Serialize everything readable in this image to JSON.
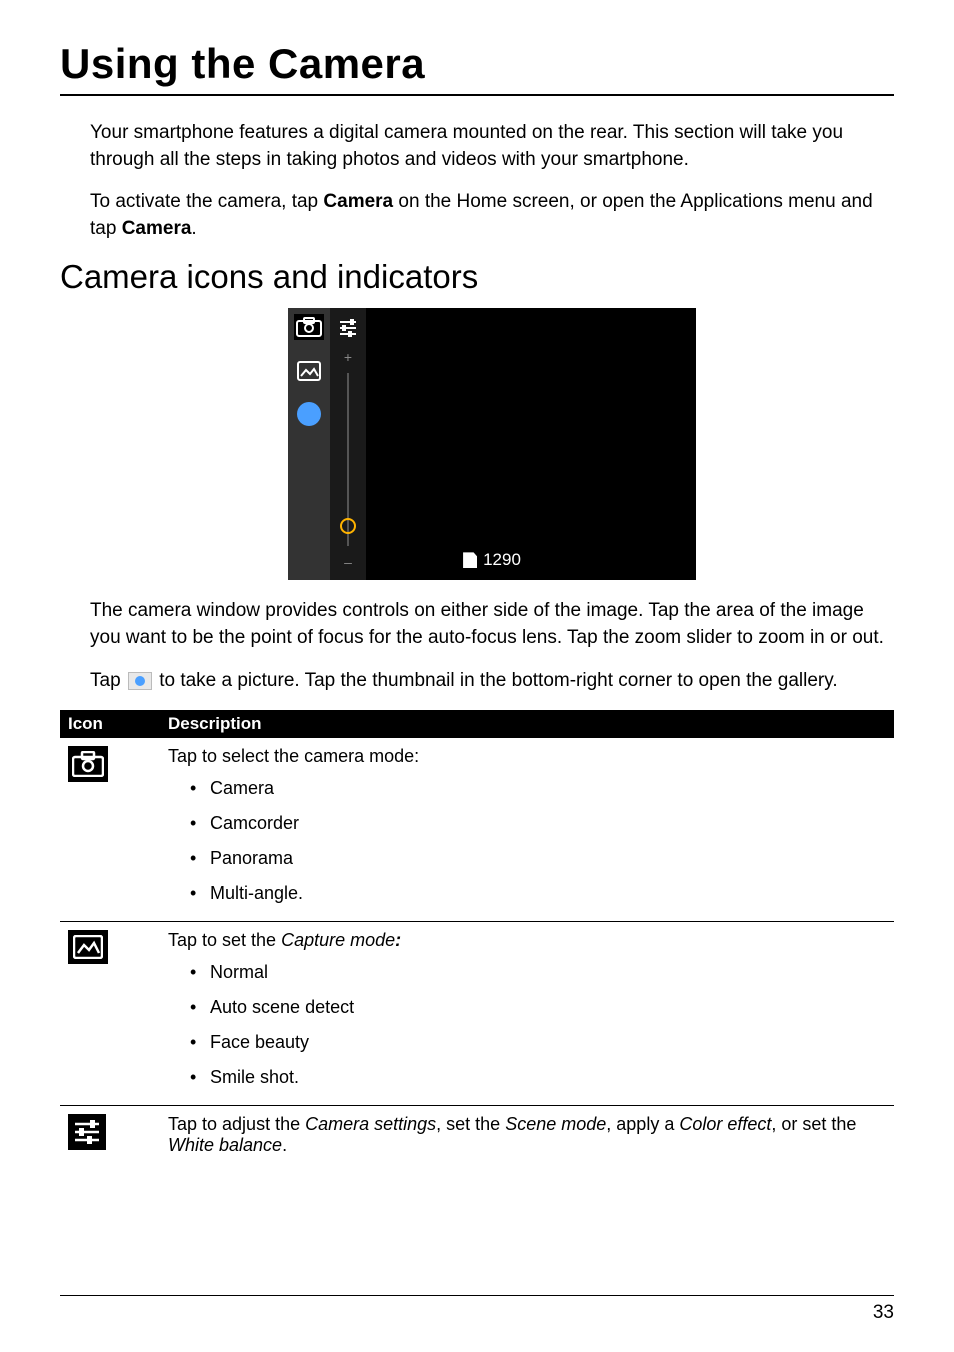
{
  "title": "Using the Camera",
  "intro1_a": "Your smartphone features a digital camera mounted on the rear. This section will take you through all the steps in taking photos and videos with your smartphone.",
  "intro2_a": "To activate the camera, tap ",
  "intro2_b": "Camera",
  "intro2_c": " on the Home screen, or open the Applications menu and tap ",
  "intro2_d": "Camera",
  "intro2_e": ".",
  "section_heading": "Camera icons and indicators",
  "screenshot": {
    "counter": "1290",
    "zoom_plus": "+",
    "zoom_minus": "–"
  },
  "after_shot_p1": "The camera window provides controls on either side of the image. Tap the area of the image you want to be the point of focus for the auto-focus lens. Tap the zoom slider to zoom in or out.",
  "after_shot_p2_a": "Tap ",
  "after_shot_p2_b": " to take a picture. Tap the thumbnail in the bottom-right corner to open the gallery.",
  "table": {
    "col_icon": "Icon",
    "col_desc": "Description",
    "rows": [
      {
        "lead": "Tap to select the camera mode:",
        "items": [
          "Camera",
          "Camcorder",
          "Panorama",
          "Multi-angle."
        ]
      },
      {
        "lead_a": "Tap to set the ",
        "lead_em": "Capture mode",
        "lead_colon": ":",
        "items": [
          "Normal",
          "Auto scene detect",
          "Face beauty",
          "Smile shot."
        ]
      },
      {
        "lead_a": "Tap to adjust the ",
        "em1": "Camera settings",
        "mid1": ", set the ",
        "em2": "Scene mode",
        "mid2": ", apply a ",
        "em3": "Color effect",
        "mid3": ", or set the ",
        "em4": "White balance",
        "end": "."
      }
    ]
  },
  "page_number": "33"
}
